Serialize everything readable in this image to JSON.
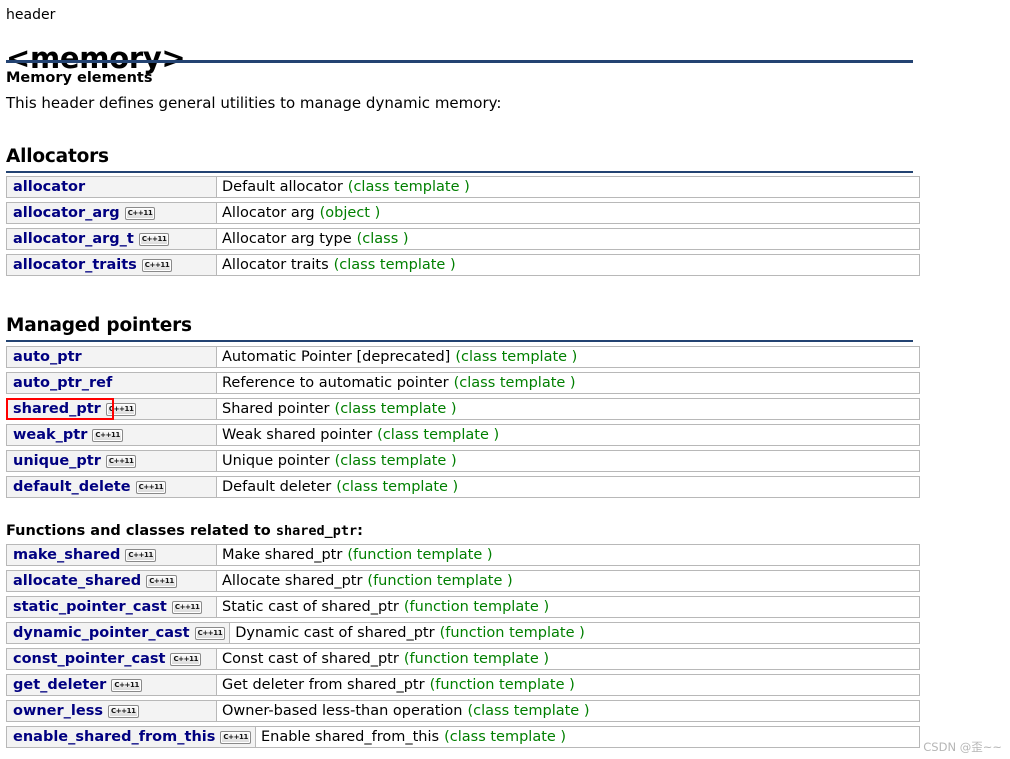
{
  "header": {
    "kicker": "header",
    "title": "<memory>",
    "subhead": "Memory elements",
    "intro": "This header defines general utilities to manage dynamic memory:"
  },
  "badge_label": "C++11",
  "colors": {
    "link": "#000080",
    "kind": "#007f00",
    "rule": "#234372",
    "highlight": "#ff0000",
    "row_border": "#b8b8b8",
    "name_cell_bg": "#f3f3f3",
    "watermark": "#b6b6b6"
  },
  "sections": [
    {
      "id": "allocators",
      "title": "Allocators",
      "rows": [
        {
          "name": "allocator",
          "cpp11": false,
          "desc": "Default allocator",
          "kind": "(class template )"
        },
        {
          "name": "allocator_arg",
          "cpp11": true,
          "desc": "Allocator arg",
          "kind": "(object )"
        },
        {
          "name": "allocator_arg_t",
          "cpp11": true,
          "desc": "Allocator arg type",
          "kind": "(class )"
        },
        {
          "name": "allocator_traits",
          "cpp11": true,
          "desc": "Allocator traits",
          "kind": "(class template )"
        }
      ]
    },
    {
      "id": "managed-pointers",
      "title": "Managed pointers",
      "rows": [
        {
          "name": "auto_ptr",
          "cpp11": false,
          "desc": "Automatic Pointer [deprecated]",
          "kind": "(class template )"
        },
        {
          "name": "auto_ptr_ref",
          "cpp11": false,
          "desc": "Reference to automatic pointer",
          "kind": "(class template )"
        },
        {
          "name": "shared_ptr",
          "cpp11": true,
          "desc": "Shared pointer",
          "kind": "(class template )",
          "highlighted": true
        },
        {
          "name": "weak_ptr",
          "cpp11": true,
          "desc": "Weak shared pointer",
          "kind": "(class template )"
        },
        {
          "name": "unique_ptr",
          "cpp11": true,
          "desc": "Unique pointer",
          "kind": "(class template )"
        },
        {
          "name": "default_delete",
          "cpp11": true,
          "desc": "Default deleter",
          "kind": "(class template )"
        }
      ]
    }
  ],
  "functions_section": {
    "title_prefix": "Functions and classes related to ",
    "title_mono": "shared_ptr",
    "title_suffix": ":",
    "rows": [
      {
        "name": "make_shared",
        "cpp11": true,
        "desc": "Make shared_ptr",
        "kind": "(function template )",
        "auto_width": false
      },
      {
        "name": "allocate_shared",
        "cpp11": true,
        "desc": "Allocate shared_ptr",
        "kind": "(function template )",
        "auto_width": false
      },
      {
        "name": "static_pointer_cast",
        "cpp11": true,
        "desc": "Static cast of shared_ptr",
        "kind": "(function template )",
        "auto_width": false
      },
      {
        "name": "dynamic_pointer_cast",
        "cpp11": true,
        "desc": "Dynamic cast of shared_ptr",
        "kind": "(function template )",
        "auto_width": true
      },
      {
        "name": "const_pointer_cast",
        "cpp11": true,
        "desc": "Const cast of shared_ptr",
        "kind": "(function template )",
        "auto_width": false
      },
      {
        "name": "get_deleter",
        "cpp11": true,
        "desc": "Get deleter from shared_ptr",
        "kind": "(function template )",
        "auto_width": false
      },
      {
        "name": "owner_less",
        "cpp11": true,
        "desc": "Owner-based less-than operation",
        "kind": "(class template )",
        "auto_width": false
      },
      {
        "name": "enable_shared_from_this",
        "cpp11": true,
        "desc": "Enable shared_from_this",
        "kind": "(class template )",
        "auto_width": true
      }
    ]
  },
  "watermark": "CSDN @歪~~"
}
